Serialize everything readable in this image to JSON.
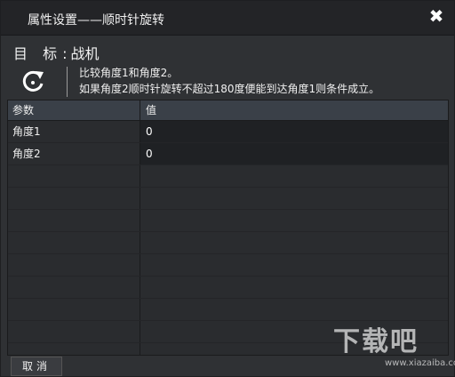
{
  "dialog": {
    "title": "属性设置——顺时针旋转",
    "close_glyph": "✖"
  },
  "target": {
    "label": "目 标",
    "colon": ":",
    "value": "战机"
  },
  "description": {
    "icon": "rotate-clockwise-icon",
    "line1": "比较角度1和角度2。",
    "line2": "如果角度2顺时针旋转不超过180度便能到达角度1则条件成立。"
  },
  "grid": {
    "headers": [
      "参数",
      "值"
    ],
    "rows": [
      {
        "param": "角度1",
        "value": "0"
      },
      {
        "param": "角度2",
        "value": "0"
      }
    ]
  },
  "footer": {
    "cancel_label": "取消"
  },
  "watermark": {
    "text": "下载吧",
    "sub": "www.xiazaiba.com"
  }
}
